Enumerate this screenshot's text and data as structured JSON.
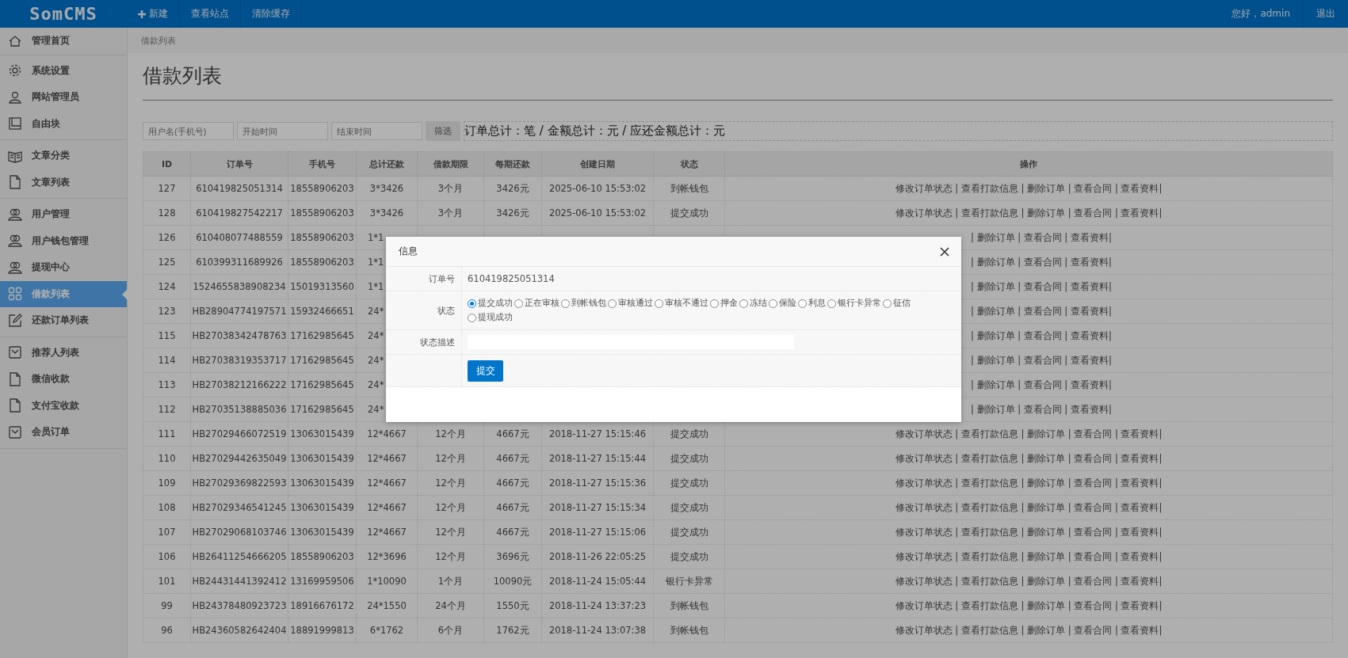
{
  "topbar": {
    "logo": "SomCMS",
    "menu": [
      {
        "label": "新建",
        "kind": "add"
      },
      {
        "label": "查看站点",
        "kind": "plain"
      },
      {
        "label": "清除缓存",
        "kind": "plain"
      }
    ],
    "greeting": "您好，admin",
    "logout": "退出"
  },
  "sidebar": {
    "groups": [
      {
        "items": [
          {
            "label": "管理首页",
            "selected": false
          }
        ]
      },
      {
        "items": [
          {
            "label": "系统设置",
            "selected": false
          },
          {
            "label": "网站管理员",
            "selected": false
          },
          {
            "label": "自由块",
            "selected": false
          }
        ]
      },
      {
        "items": [
          {
            "label": "文章分类",
            "selected": false
          },
          {
            "label": "文章列表",
            "selected": false
          }
        ]
      },
      {
        "items": [
          {
            "label": "用户管理",
            "selected": false
          },
          {
            "label": "用户钱包管理",
            "selected": false
          },
          {
            "label": "提现中心",
            "selected": false
          },
          {
            "label": "借款列表",
            "selected": true
          },
          {
            "label": "还款订单列表",
            "selected": false
          }
        ]
      },
      {
        "items": [
          {
            "label": "推荐人列表",
            "selected": false
          },
          {
            "label": "微信收款",
            "selected": false
          },
          {
            "label": "支付宝收款",
            "selected": false
          },
          {
            "label": "会员订单",
            "selected": false
          }
        ]
      }
    ]
  },
  "breadcrumb": "借款列表",
  "page_title": "借款列表",
  "filter": {
    "user_placeholder": "用户名(手机号)",
    "start_placeholder": "开始时间",
    "end_placeholder": "结束时间",
    "button": "筛选",
    "summary": "订单总计：笔 / 金额总计：元 / 应还金额总计：元"
  },
  "table": {
    "columns": [
      "ID",
      "订单号",
      "手机号",
      "总计还款",
      "借款期限",
      "每期还款",
      "创建日期",
      "状态",
      "操作"
    ],
    "rows": [
      {
        "id": "127",
        "order": "610419825051314",
        "phone": "18558906203",
        "total": "3*3426",
        "term": "3个月",
        "per": "3426元",
        "date": "2025-06-10 15:53:02",
        "status": "到帐钱包",
        "actions": "修改订单状态 | 查看打款信息 | 删除订单 | 查看合同 | 查看资料|"
      },
      {
        "id": "128",
        "order": "610419827542217",
        "phone": "18558906203",
        "total": "3*3426",
        "term": "3个月",
        "per": "3426元",
        "date": "2025-06-10 15:53:02",
        "status": "提交成功",
        "actions": "修改订单状态 | 查看打款信息 | 删除订单 | 查看合同 | 查看资料|"
      },
      {
        "id": "126",
        "order": "610408077488559",
        "phone": "18558906203",
        "total": "1*1",
        "actions": "| 删除订单 | 查看合同 | 查看资料|"
      },
      {
        "id": "125",
        "order": "610399311689926",
        "phone": "18558906203",
        "total": "1*1",
        "actions": "| 删除订单 | 查看合同 | 查看资料|"
      },
      {
        "id": "124",
        "order": "1524655838908234",
        "phone": "15019313560",
        "total": "1*1",
        "actions": "| 删除订单 | 查看合同 | 查看资料|"
      },
      {
        "id": "123",
        "order": "HB28904774197571",
        "phone": "15932466651",
        "total": "24*",
        "actions": "| 删除订单 | 查看合同 | 查看资料|"
      },
      {
        "id": "115",
        "order": "HB27038342478763",
        "phone": "17162985645",
        "total": "24*",
        "actions": "| 删除订单 | 查看合同 | 查看资料|"
      },
      {
        "id": "114",
        "order": "HB27038319353717",
        "phone": "17162985645",
        "total": "24*",
        "actions": "| 删除订单 | 查看合同 | 查看资料|"
      },
      {
        "id": "113",
        "order": "HB27038212166222",
        "phone": "17162985645",
        "total": "24*",
        "actions": "| 删除订单 | 查看合同 | 查看资料|"
      },
      {
        "id": "112",
        "order": "HB27035138885036",
        "phone": "17162985645",
        "total": "24*",
        "actions": "| 删除订单 | 查看合同 | 查看资料|"
      },
      {
        "id": "111",
        "order": "HB27029466072519",
        "phone": "13063015439",
        "total": "12*4667",
        "term": "12个月",
        "per": "4667元",
        "date": "2018-11-27 15:15:46",
        "status": "提交成功",
        "actions": "修改订单状态 | 查看打款信息 | 删除订单 | 查看合同 | 查看资料|"
      },
      {
        "id": "110",
        "order": "HB27029442635049",
        "phone": "13063015439",
        "total": "12*4667",
        "term": "12个月",
        "per": "4667元",
        "date": "2018-11-27 15:15:44",
        "status": "提交成功",
        "actions": "修改订单状态 | 查看打款信息 | 删除订单 | 查看合同 | 查看资料|"
      },
      {
        "id": "109",
        "order": "HB27029369822593",
        "phone": "13063015439",
        "total": "12*4667",
        "term": "12个月",
        "per": "4667元",
        "date": "2018-11-27 15:15:36",
        "status": "提交成功",
        "actions": "修改订单状态 | 查看打款信息 | 删除订单 | 查看合同 | 查看资料|"
      },
      {
        "id": "108",
        "order": "HB27029346541245",
        "phone": "13063015439",
        "total": "12*4667",
        "term": "12个月",
        "per": "4667元",
        "date": "2018-11-27 15:15:34",
        "status": "提交成功",
        "actions": "修改订单状态 | 查看打款信息 | 删除订单 | 查看合同 | 查看资料|"
      },
      {
        "id": "107",
        "order": "HB27029068103746",
        "phone": "13063015439",
        "total": "12*4667",
        "term": "12个月",
        "per": "4667元",
        "date": "2018-11-27 15:15:06",
        "status": "提交成功",
        "actions": "修改订单状态 | 查看打款信息 | 删除订单 | 查看合同 | 查看资料|"
      },
      {
        "id": "106",
        "order": "HB26411254666205",
        "phone": "18558906203",
        "total": "12*3696",
        "term": "12个月",
        "per": "3696元",
        "date": "2018-11-26 22:05:25",
        "status": "提交成功",
        "actions": "修改订单状态 | 查看打款信息 | 删除订单 | 查看合同 | 查看资料|"
      },
      {
        "id": "101",
        "order": "HB24431441392412",
        "phone": "13169959506",
        "total": "1*10090",
        "term": "1个月",
        "per": "10090元",
        "date": "2018-11-24 15:05:44",
        "status": "银行卡异常",
        "actions": "修改订单状态 | 查看打款信息 | 删除订单 | 查看合同 | 查看资料|"
      },
      {
        "id": "99",
        "order": "HB24378480923723",
        "phone": "18916676172",
        "total": "24*1550",
        "term": "24个月",
        "per": "1550元",
        "date": "2018-11-24 13:37:23",
        "status": "到帐钱包",
        "actions": "修改订单状态 | 查看打款信息 | 删除订单 | 查看合同 | 查看资料|"
      },
      {
        "id": "96",
        "order": "HB24360582642404",
        "phone": "18891999813",
        "total": "6*1762",
        "term": "6个月",
        "per": "1762元",
        "date": "2018-11-24 13:07:38",
        "status": "到帐钱包",
        "actions": "修改订单状态 | 查看打款信息 | 删除订单 | 查看合同 | 查看资料|"
      }
    ]
  },
  "dialog": {
    "title": "信息",
    "order_label": "订单号",
    "order_value": "610419825051314",
    "status_label": "状态",
    "options": [
      {
        "label": "提交成功",
        "selected": true
      },
      {
        "label": "正在审核",
        "selected": false
      },
      {
        "label": "到帐钱包",
        "selected": false
      },
      {
        "label": "审核通过",
        "selected": false
      },
      {
        "label": "审核不通过",
        "selected": false
      },
      {
        "label": "押金",
        "selected": false
      },
      {
        "label": "冻结",
        "selected": false
      },
      {
        "label": "保险",
        "selected": false
      },
      {
        "label": "利息",
        "selected": false
      },
      {
        "label": "银行卡异常",
        "selected": false
      },
      {
        "label": "征信",
        "selected": false
      },
      {
        "label": "提现成功",
        "selected": false
      }
    ],
    "desc_label": "状态描述",
    "submit": "提交"
  }
}
